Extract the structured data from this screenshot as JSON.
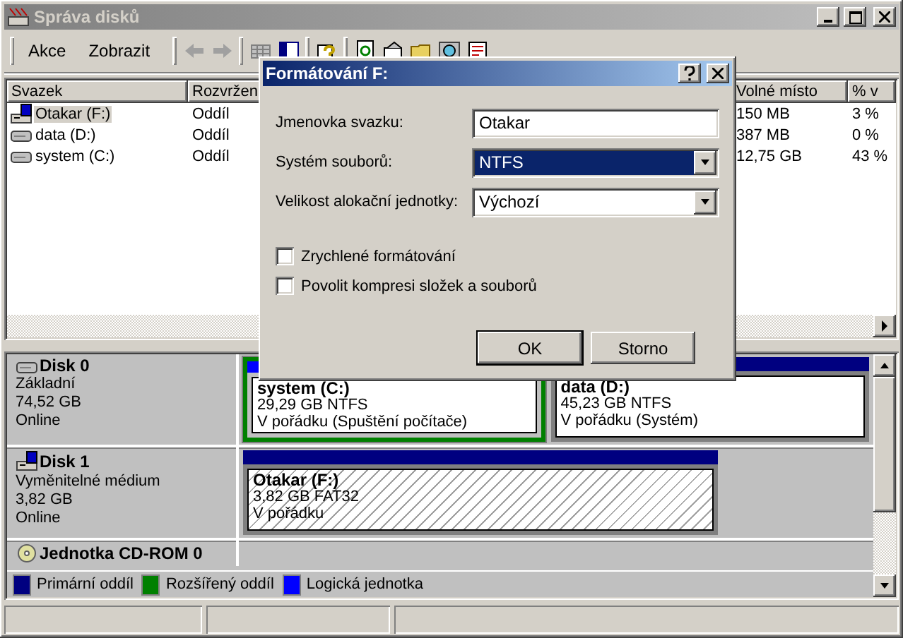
{
  "window": {
    "title": "Správa disků"
  },
  "menu": [
    {
      "label": "Akce"
    },
    {
      "label": "Zobrazit"
    }
  ],
  "volume_table": {
    "columns": [
      "Svazek",
      "Rozvržen",
      "Volné místo",
      "% v"
    ],
    "rows": [
      {
        "volume": "Otakar (F:)",
        "kind": "removable",
        "layout": "Oddíl",
        "free": "150 MB",
        "percent": "3 %",
        "selected": true
      },
      {
        "volume": "data (D:)",
        "kind": "hdd",
        "layout": "Oddíl",
        "free": "387 MB",
        "percent": "0 %",
        "selected": false
      },
      {
        "volume": "system (C:)",
        "kind": "hdd",
        "layout": "Oddíl",
        "free": "12,75 GB",
        "percent": "43 %",
        "selected": false
      }
    ]
  },
  "disks": [
    {
      "name": "Disk 0",
      "kind": "hdd",
      "type": "Základní",
      "size": "74,52 GB",
      "status": "Online",
      "partitions": [
        {
          "name": "system  (C:)",
          "size_fs": "29,29 GB NTFS",
          "status": "V pořádku (Spuštění počítače)",
          "kind": "logical",
          "selected": false
        },
        {
          "name": "data  (D:)",
          "size_fs": "45,23 GB NTFS",
          "status": "V pořádku (Systém)",
          "kind": "primary",
          "selected": false
        }
      ]
    },
    {
      "name": "Disk 1",
      "kind": "removable",
      "type": "Vyměnitelné médium",
      "size": "3,82 GB",
      "status": "Online",
      "partitions": [
        {
          "name": "Otakar  (F:)",
          "size_fs": "3,82 GB FAT32",
          "status": "V pořádku",
          "kind": "primary",
          "selected": true
        }
      ]
    },
    {
      "name": "Jednotka CD-ROM 0",
      "kind": "cdrom"
    }
  ],
  "legend": [
    {
      "label": "Primární oddíl",
      "color": "#000080"
    },
    {
      "label": "Rozšířený oddíl",
      "color": "#008000"
    },
    {
      "label": "Logická jednotka",
      "color": "#0000ff"
    }
  ],
  "dialog": {
    "title": "Formátování F:",
    "fields": [
      {
        "label": "Jmenovka svazku:",
        "kind": "text",
        "value": "Otakar",
        "focused": false
      },
      {
        "label": "Systém souborů:",
        "kind": "dropdown",
        "value": "NTFS",
        "focused": true
      },
      {
        "label": "Velikost alokační jednotky:",
        "kind": "dropdown",
        "value": "Výchozí",
        "focused": false
      }
    ],
    "options": [
      {
        "label": "Zrychlené formátování",
        "checked": false
      },
      {
        "label": "Povolit kompresi složek a souborů",
        "checked": false
      }
    ],
    "buttons": [
      {
        "label": "OK",
        "default": true
      },
      {
        "label": "Storno",
        "default": false
      }
    ]
  }
}
